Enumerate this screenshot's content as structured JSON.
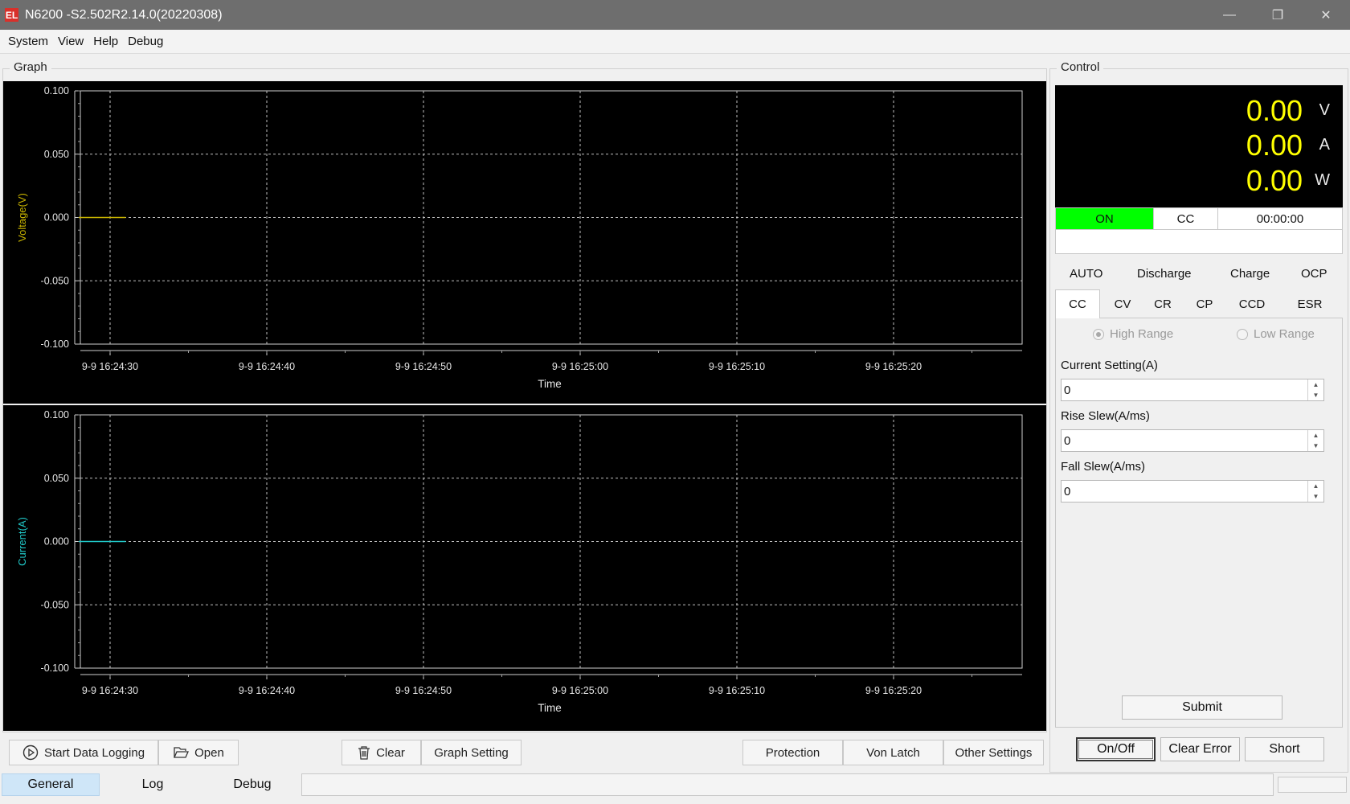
{
  "window": {
    "logo": "EL",
    "title": "N6200 -S2.502R2.14.0(20220308)",
    "minimize_glyph": "—",
    "restore_glyph": "❐",
    "close_glyph": "✕"
  },
  "menu": [
    "System",
    "View",
    "Help",
    "Debug"
  ],
  "graph": {
    "group_title": "Graph",
    "background": "#000000",
    "grid_color": "#bfbfbf"
  },
  "chart_data": [
    {
      "type": "line",
      "ylabel": "Voltage(V)",
      "xlabel": "Time",
      "ylim": [
        -0.1,
        0.1
      ],
      "y_ticks": [
        "0.100",
        "0.050",
        "0.000",
        "-0.050",
        "-0.100"
      ],
      "x_ticks": [
        "9-9 16:24:30",
        "9-9 16:24:40",
        "9-9 16:24:50",
        "9-9 16:25:00",
        "9-9 16:25:10",
        "9-9 16:25:20"
      ],
      "grid": true,
      "series": [
        {
          "color": "#c8b400",
          "x": [
            "9-9 16:24:28",
            "9-9 16:24:31"
          ],
          "values": [
            0,
            0
          ]
        }
      ]
    },
    {
      "type": "line",
      "ylabel": "Current(A)",
      "xlabel": "Time",
      "ylim": [
        -0.1,
        0.1
      ],
      "y_ticks": [
        "0.100",
        "0.050",
        "0.000",
        "-0.050",
        "-0.100"
      ],
      "x_ticks": [
        "9-9 16:24:30",
        "9-9 16:24:40",
        "9-9 16:24:50",
        "9-9 16:25:00",
        "9-9 16:25:10",
        "9-9 16:25:20"
      ],
      "grid": true,
      "series": [
        {
          "color": "#20c8c8",
          "x": [
            "9-9 16:24:28",
            "9-9 16:24:31"
          ],
          "values": [
            0,
            0
          ]
        }
      ]
    }
  ],
  "graph_buttons": {
    "start_logging": "Start Data Logging",
    "open": "Open",
    "clear": "Clear",
    "graph_setting": "Graph Setting",
    "protection": "Protection",
    "von_latch": "Von Latch",
    "other_settings": "Other Settings"
  },
  "bottom_tabs": [
    "General",
    "Log",
    "Debug"
  ],
  "control": {
    "group_title": "Control",
    "display": {
      "voltage": "0.00",
      "voltage_unit": "V",
      "current": "0.00",
      "current_unit": "A",
      "power": "0.00",
      "power_unit": "W",
      "value_color": "#ffff00"
    },
    "status": {
      "state": "ON",
      "state_color": "#00ff00",
      "mode": "CC",
      "timer": "00:00:00"
    },
    "mode_tabs_row1": [
      "AUTO",
      "Discharge",
      "Charge",
      "OCP"
    ],
    "mode_tabs_row2": [
      "CC",
      "CV",
      "CR",
      "CP",
      "CCD",
      "ESR"
    ],
    "active_mode_tab": "CC",
    "range": {
      "high": "High Range",
      "low": "Low Range",
      "selected": "High Range"
    },
    "fields": [
      {
        "label": "Current Setting(A)",
        "value": "0"
      },
      {
        "label": "Rise Slew(A/ms)",
        "value": "0"
      },
      {
        "label": "Fall Slew(A/ms)",
        "value": "0"
      }
    ],
    "submit": "Submit",
    "on_off": "On/Off",
    "clear_error": "Clear Error",
    "short": "Short"
  }
}
